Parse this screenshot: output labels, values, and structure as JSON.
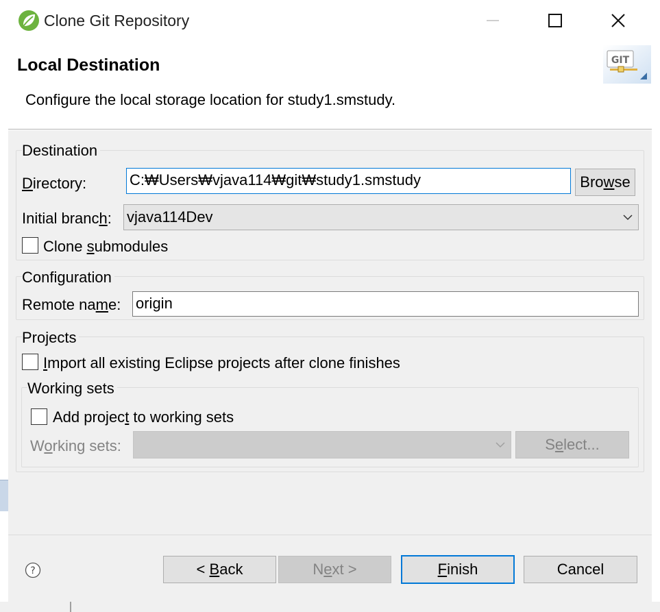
{
  "window": {
    "title": "Clone Git Repository",
    "icons": {
      "app": "spring-leaf-icon",
      "minimize": "minimize-icon",
      "maximize": "maximize-icon",
      "close": "close-icon"
    }
  },
  "header": {
    "title": "Local Destination",
    "description": "Configure the local storage location for study1.smstudy.",
    "banner_text": "GIT"
  },
  "destination": {
    "legend": "Destination",
    "directory_label": "Directory:",
    "directory_value": "C:₩Users₩vjava114₩git₩study1.smstudy",
    "browse_label": "Browse",
    "initial_branch_label": "Initial branch:",
    "initial_branch_value": "vjava114Dev",
    "clone_submodules_label": "Clone submodules",
    "clone_submodules_checked": false
  },
  "configuration": {
    "legend": "Configuration",
    "remote_name_label": "Remote name:",
    "remote_name_value": "origin"
  },
  "projects": {
    "legend": "Projects",
    "import_label": "Import all existing Eclipse projects after clone finishes",
    "import_checked": false,
    "working_sets": {
      "legend": "Working sets",
      "add_label": "Add project to working sets",
      "add_checked": false,
      "working_sets_label": "Working sets:",
      "working_sets_value": "",
      "select_label": "Select..."
    }
  },
  "footer": {
    "back_label": "< Back",
    "next_label": "Next >",
    "finish_label": "Finish",
    "cancel_label": "Cancel",
    "help_icon": "help-icon"
  },
  "colors": {
    "accent": "#0078d7",
    "dialog_bg": "#f0f0f0",
    "disabled_text": "#838383"
  }
}
